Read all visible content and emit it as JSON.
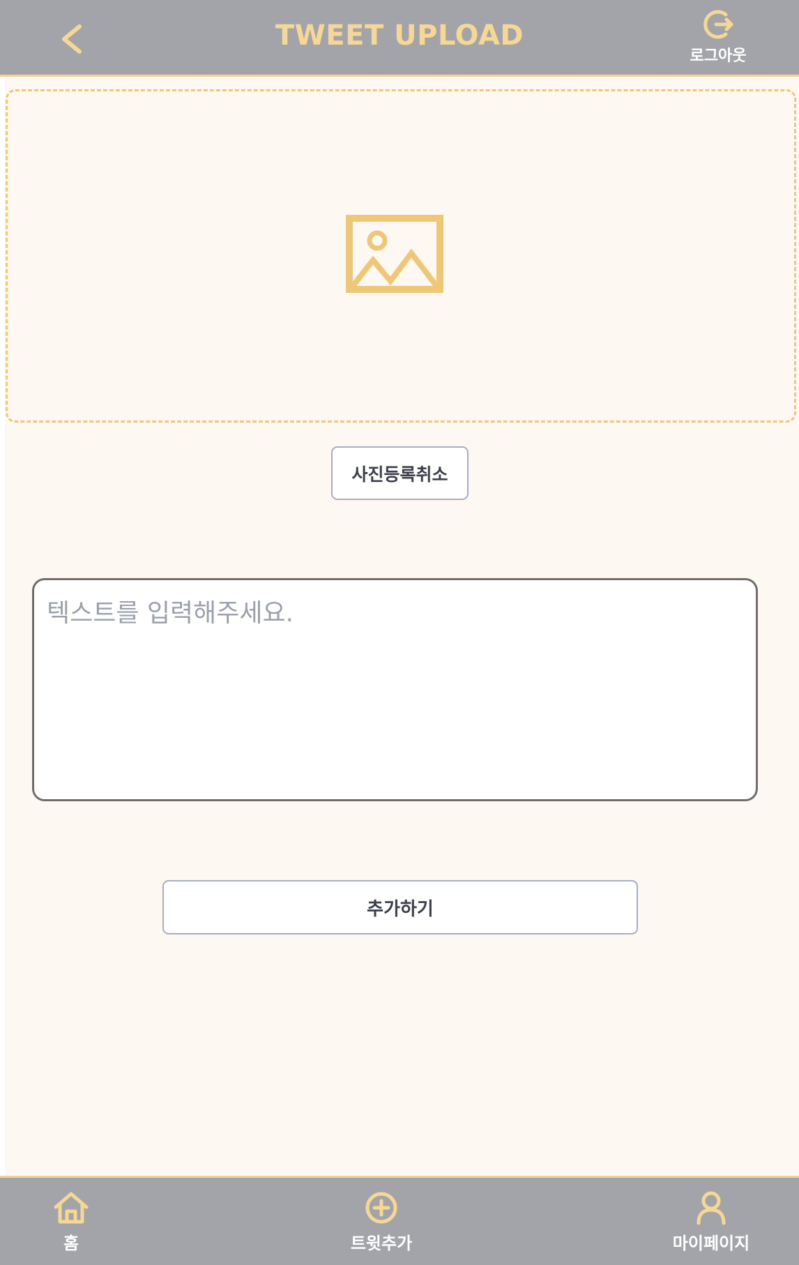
{
  "header": {
    "title": "TWEET UPLOAD",
    "logout_label": "로그아웃"
  },
  "upload": {
    "cancel_photo_label": "사진등록취소",
    "textarea_placeholder": "텍스트를 입력해주세요.",
    "textarea_value": "",
    "submit_label": "추가하기"
  },
  "bottom_nav": {
    "items": [
      {
        "label": "홈",
        "icon": "home-icon"
      },
      {
        "label": "트윗추가",
        "icon": "plus-circle-icon"
      },
      {
        "label": "마이페이지",
        "icon": "user-icon"
      }
    ]
  },
  "colors": {
    "bar_bg": "#a3a3aa",
    "accent": "#f0c777",
    "page_bg": "#fdf8f2"
  }
}
